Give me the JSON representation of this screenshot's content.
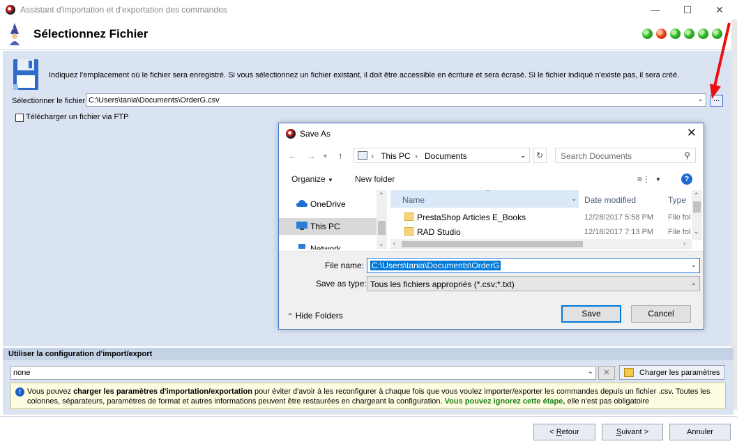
{
  "window": {
    "title": "Assistant d'importation et d'exportation des commandes",
    "minimize_icon": "minimize-icon",
    "maximize_icon": "maximize-icon",
    "close_icon": "close-icon"
  },
  "header": {
    "title": "Sélectionnez Fichier",
    "step_dots": [
      "green",
      "red",
      "green",
      "green",
      "green",
      "green"
    ]
  },
  "file_section": {
    "info": "Indiquez l'emplacement où le fichier sera enregistré. Si vous sélectionnez un fichier existant, il doit être accessible en écriture et sera écrasé. Si le fichier indiqué n'existe pas, il sera créé.",
    "select_label": "Sélectionner le fichier",
    "file_path": "C:\\Users\\tania\\Documents\\OrderG.csv",
    "browse_label": "...",
    "ftp_checkbox_label": "Télécharger un fichier via FTP",
    "ftp_checked": false
  },
  "config": {
    "heading": "Utiliser la configuration d'import/export",
    "selected": "none",
    "load_button": "Charger les paramètres",
    "hint_part1": "Vous pouvez ",
    "hint_bold": "charger les paramètres d'importation/exportation",
    "hint_part2": " pour éviter d'avoir à les reconfigurer à chaque fois que vous voulez importer/exporter les commandes depuis un fichier .csv. Toutes les colonnes, séparateurs, paramètres de format et autres informations peuvent être restaurées en chargeant la configuration. ",
    "hint_green": "Vous pouvez ignorez cette étape,",
    "hint_part3": " elle n'est pas obligatoire"
  },
  "footer": {
    "back_prefix": "< ",
    "back_underlined": "R",
    "back_rest": "etour",
    "next_underlined": "S",
    "next_rest": "uivant >",
    "cancel": "Annuler"
  },
  "dialog": {
    "title": "Save As",
    "breadcrumb": [
      "This PC",
      "Documents"
    ],
    "search_placeholder": "Search Documents",
    "organize": "Organize",
    "new_folder": "New folder",
    "help": "?",
    "nav_items": [
      {
        "label": "OneDrive",
        "icon": "cloud-icon"
      },
      {
        "label": "This PC",
        "icon": "computer-icon"
      },
      {
        "label": "Network",
        "icon": "network-icon"
      }
    ],
    "columns": [
      "Name",
      "Date modified",
      "Type"
    ],
    "files": [
      {
        "name": "PrestaShop Articles E_Books",
        "date": "12/28/2017 5:58 PM",
        "type": "File fol"
      },
      {
        "name": "RAD Studio",
        "date": "12/18/2017 7:13 PM",
        "type": "File fol"
      }
    ],
    "file_name_label": "File name:",
    "file_name_value": "C:\\Users\\tania\\Documents\\OrderG",
    "save_type_label": "Save as type:",
    "save_type_value": "Tous les fichiers appropriés (*.csv;*.txt)",
    "hide_folders": "Hide Folders",
    "save_button": "Save",
    "cancel_button": "Cancel"
  },
  "colors": {
    "panel_bg": "#dae3f1",
    "accent": "#0078d7",
    "annotation_arrow": "#e81010"
  }
}
